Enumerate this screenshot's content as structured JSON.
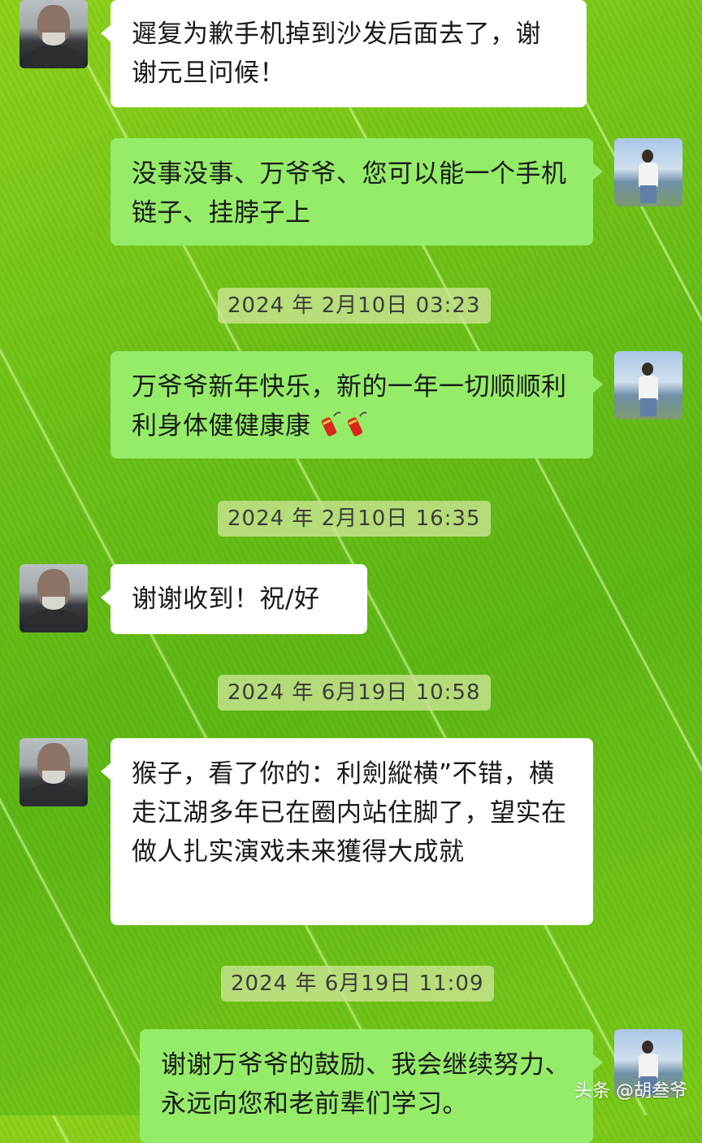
{
  "messages": [
    {
      "side": "in",
      "text": "遲复为歉手机掉到沙发后面去了，谢谢元旦问候！"
    },
    {
      "side": "out",
      "text": "没事没事、万爷爷、您可以能一个手机链子、挂脖子上"
    },
    {
      "side": "out",
      "text": "万爷爷新年快乐，新的一年一切顺顺利利身体健健康康",
      "emoji": [
        "firecracker-icon",
        "firecracker-icon"
      ]
    },
    {
      "side": "in",
      "text": "谢谢收到！祝/好"
    },
    {
      "side": "in",
      "text": "猴子，看了你的：利劍縱横”不错，横走江湖多年已在圈内站住脚了，望实在做人扎实演戏未来獲得大成就"
    },
    {
      "side": "out",
      "text": "谢谢万爷爷的鼓励、我会继续努力、永远向您和老前辈们学习。"
    }
  ],
  "timestamps": [
    "2024 年 2月10日 03:23",
    "2024 年 2月10日 16:35",
    "2024 年 6月19日 10:58",
    "2024 年 6月19日 11:09"
  ],
  "watermark": "头条 @胡叁爷"
}
